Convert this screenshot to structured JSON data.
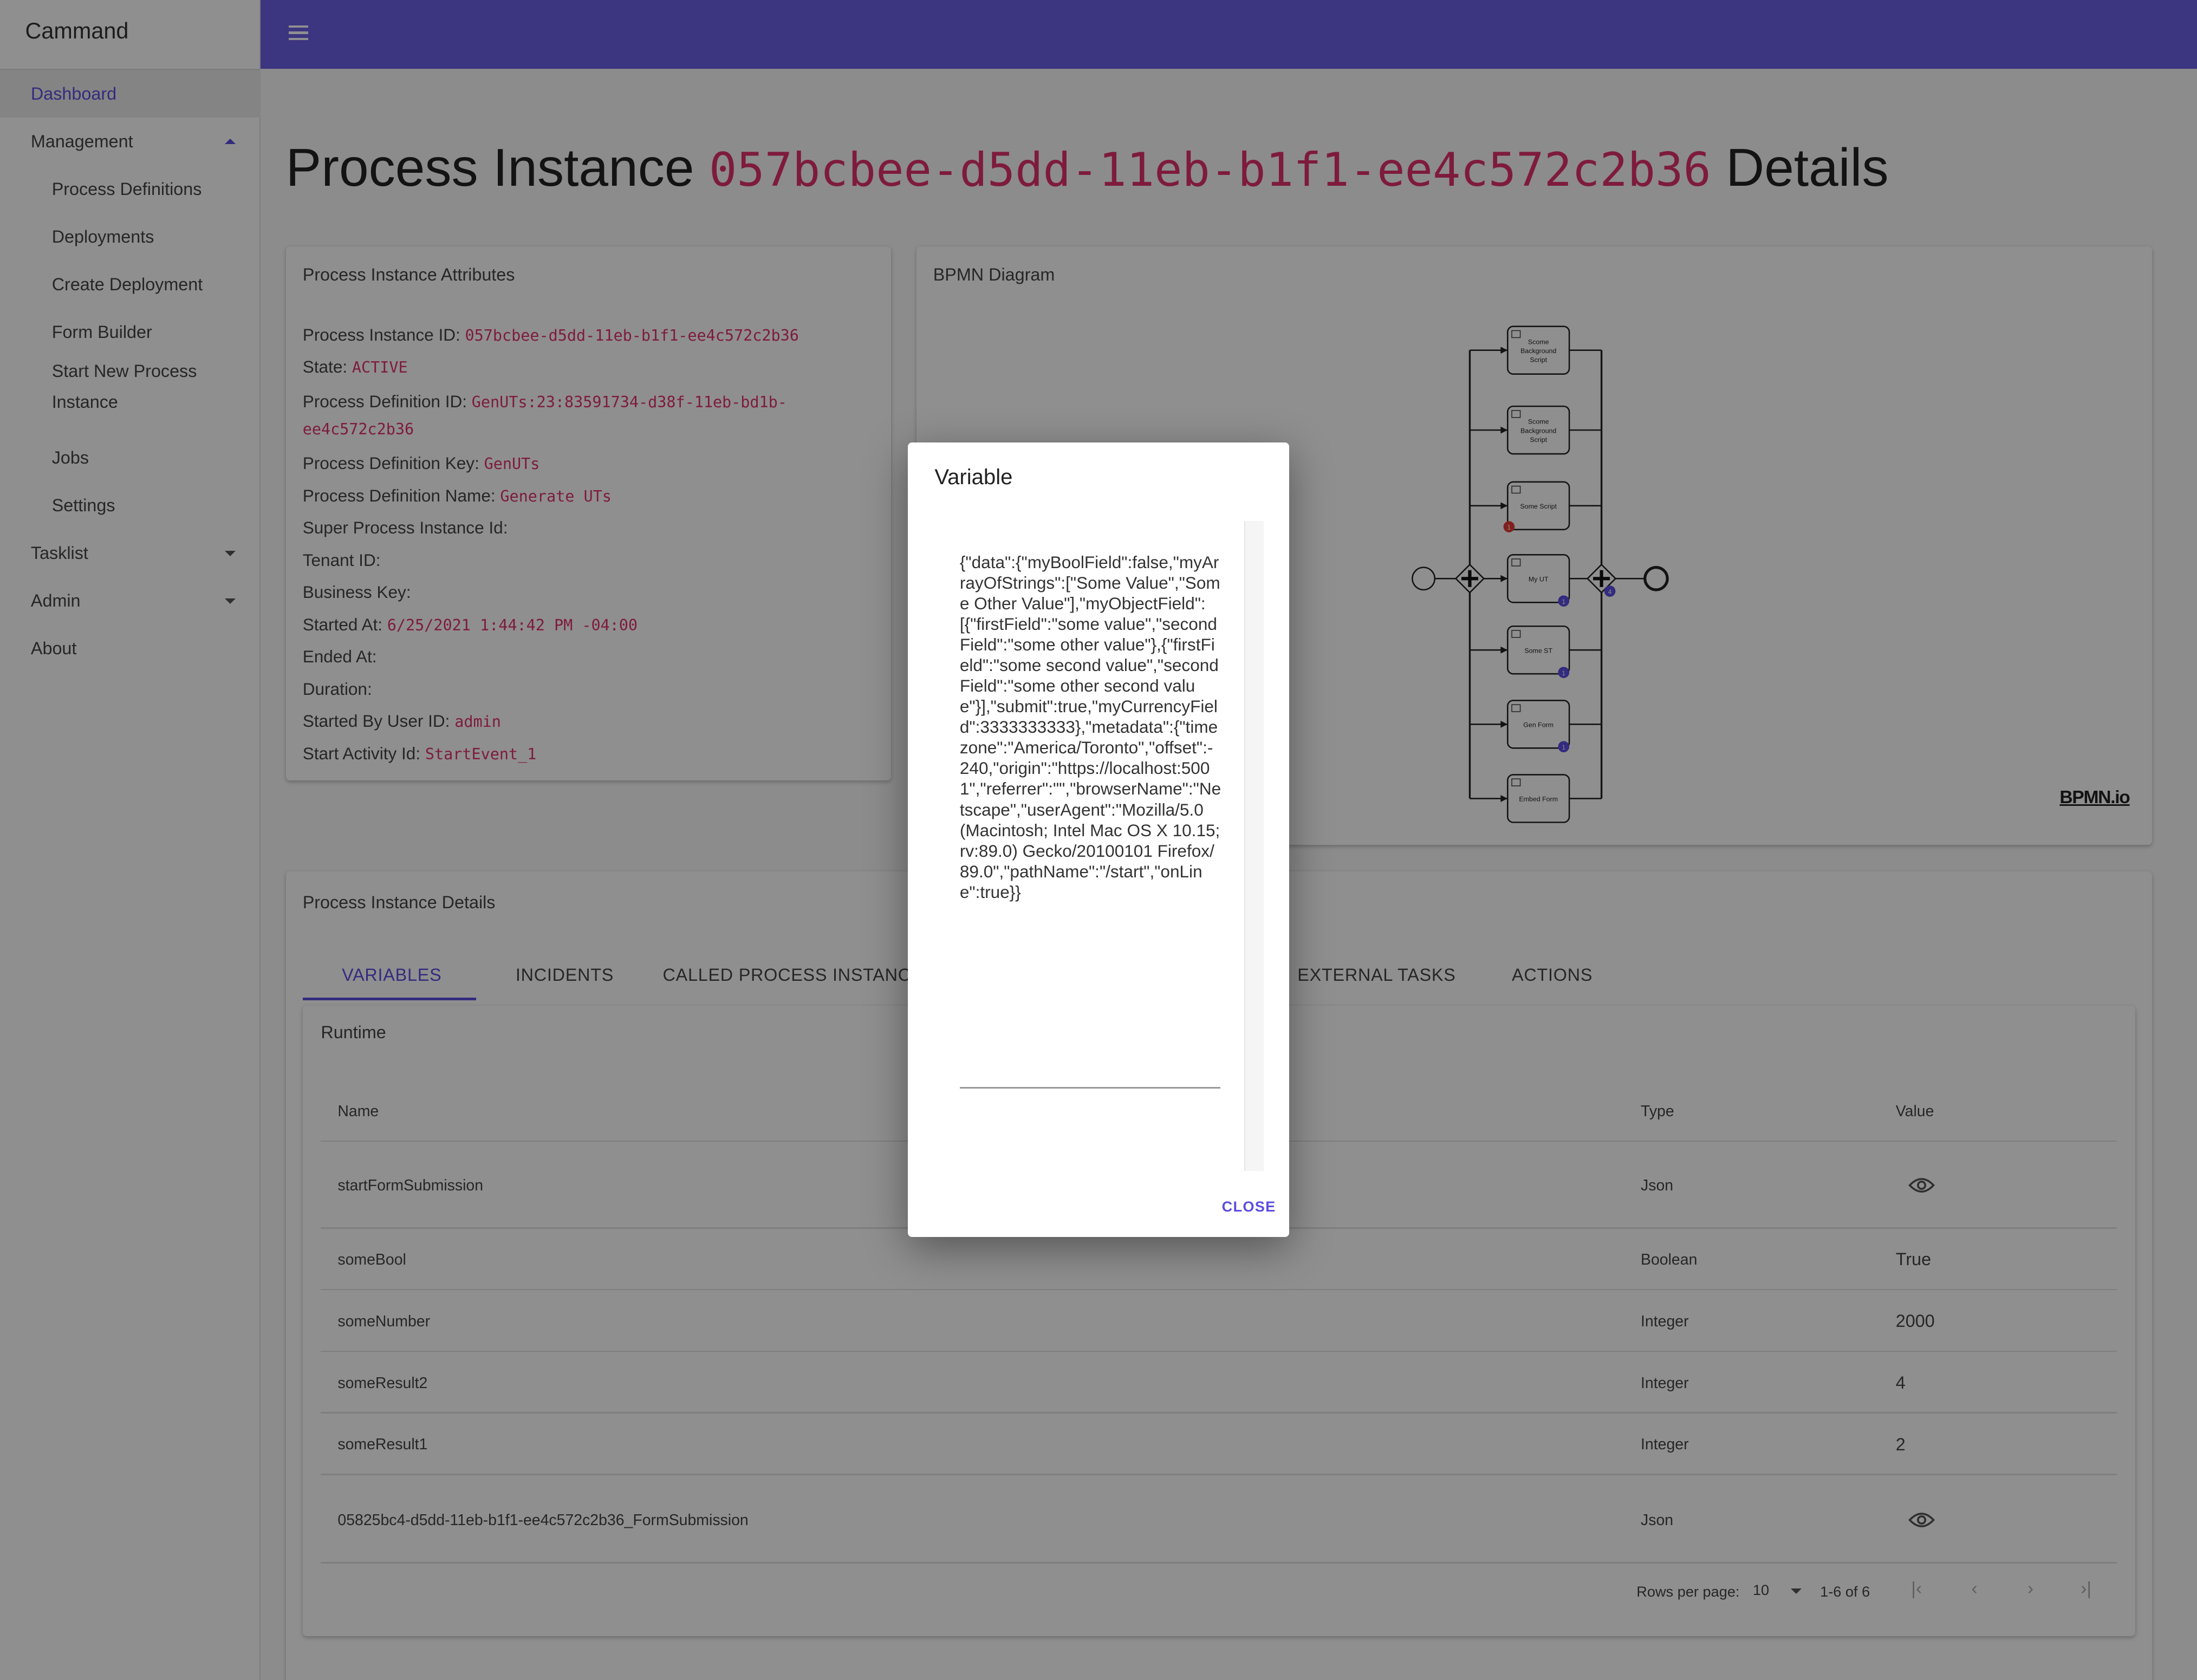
{
  "app": {
    "name": "Cammand",
    "accent": "#5b4de0",
    "header_color": "#6c5fe4",
    "code_color": "#e0306e"
  },
  "sidebar": {
    "items": [
      {
        "label": "Dashboard",
        "level": "top",
        "active": true
      },
      {
        "label": "Management",
        "level": "top",
        "caret": "up"
      },
      {
        "label": "Process Definitions",
        "level": "sub"
      },
      {
        "label": "Deployments",
        "level": "sub"
      },
      {
        "label": "Create Deployment",
        "level": "sub"
      },
      {
        "label": "Form Builder",
        "level": "sub"
      },
      {
        "label": "Start New Process Instance",
        "level": "sub"
      },
      {
        "label": "Jobs",
        "level": "sub"
      },
      {
        "label": "Settings",
        "level": "sub"
      },
      {
        "label": "Tasklist",
        "level": "top",
        "caret": "down"
      },
      {
        "label": "Admin",
        "level": "top",
        "caret": "down"
      },
      {
        "label": "About",
        "level": "top"
      }
    ]
  },
  "header": {
    "menu_icon": "hamburger-menu-icon"
  },
  "page": {
    "title_prefix": "Process Instance",
    "title_id": "057bcbee-d5dd-11eb-b1f1-ee4c572c2b36",
    "title_suffix": "Details"
  },
  "attributes": {
    "heading": "Process Instance Attributes",
    "rows": [
      {
        "label": "Process Instance ID:",
        "value": "057bcbee-d5dd-11eb-b1f1-ee4c572c2b36"
      },
      {
        "label": "State:",
        "value": "ACTIVE"
      },
      {
        "label": "Process Definition ID:",
        "value": "GenUTs:23:83591734-d38f-11eb-bd1b-ee4c572c2b36"
      },
      {
        "label": "Process Definition Key:",
        "value": "GenUTs"
      },
      {
        "label": "Process Definition Name:",
        "value": "Generate UTs"
      },
      {
        "label": "Super Process Instance Id:",
        "value": ""
      },
      {
        "label": "Tenant ID:",
        "value": ""
      },
      {
        "label": "Business Key:",
        "value": ""
      },
      {
        "label": "Started At:",
        "value": "6/25/2021 1:44:42 PM -04:00"
      },
      {
        "label": "Ended At:",
        "value": ""
      },
      {
        "label": "Duration:",
        "value": ""
      },
      {
        "label": "Started By User ID:",
        "value": "admin"
      },
      {
        "label": "Start Activity Id:",
        "value": "StartEvent_1"
      }
    ]
  },
  "bpmn": {
    "heading": "BPMN Diagram",
    "watermark": "BPMN.io",
    "tasks": [
      {
        "name": "Scome Background Script",
        "icon": "script-icon"
      },
      {
        "name": "Scome Background Script",
        "icon": "script-icon"
      },
      {
        "name": "Some Script",
        "icon": "script-icon",
        "incident_badge": "1"
      },
      {
        "name": "My UT",
        "icon": "user-icon",
        "count_badge": "1"
      },
      {
        "name": "Some ST",
        "icon": "gear-icon",
        "count_badge": "1"
      },
      {
        "name": "Gen Form",
        "icon": "user-icon",
        "count_badge": "1"
      },
      {
        "name": "Embed Form",
        "icon": "user-icon"
      }
    ],
    "join_badge": "4"
  },
  "details": {
    "heading": "Process Instance Details",
    "tabs": [
      "VARIABLES",
      "INCIDENTS",
      "CALLED PROCESS INSTANCE",
      "EXTERNAL TASKS",
      "ACTIONS"
    ],
    "section": "Runtime",
    "columns": [
      "Name",
      "Type",
      "Value"
    ],
    "rows": [
      {
        "name": "startFormSubmission",
        "type": "Json",
        "value": "",
        "value_icon": "eye-icon"
      },
      {
        "name": "someBool",
        "type": "Boolean",
        "value": "True"
      },
      {
        "name": "someNumber",
        "type": "Integer",
        "value": "2000"
      },
      {
        "name": "someResult2",
        "type": "Integer",
        "value": "4"
      },
      {
        "name": "someResult1",
        "type": "Integer",
        "value": "2"
      },
      {
        "name": "05825bc4-d5dd-11eb-b1f1-ee4c572c2b36_FormSubmission",
        "type": "Json",
        "value": "",
        "value_icon": "eye-icon"
      }
    ],
    "pagination": {
      "rows_label": "Rows per page:",
      "rows_value": "10",
      "range": "1-6 of 6"
    }
  },
  "modal": {
    "title": "Variable",
    "content": "{\"data\":{\"myBoolField\":false,\"myArrayOfStrings\":[\"Some Value\",\"Some Other Value\"],\"myObjectField\":[{\"firstField\":\"some value\",\"secondField\":\"some other value\"},{\"firstField\":\"some second value\",\"secondField\":\"some other second value\"}],\"submit\":true,\"myCurrencyField\":3333333333},\"metadata\":{\"timezone\":\"America/Toronto\",\"offset\":-240,\"origin\":\"https://localhost:5001\",\"referrer\":\"\",\"browserName\":\"Netscape\",\"userAgent\":\"Mozilla/5.0 (Macintosh; Intel Mac OS X 10.15; rv:89.0) Gecko/20100101 Firefox/89.0\",\"pathName\":\"/start\",\"onLine\":true}}",
    "close_label": "CLOSE"
  }
}
